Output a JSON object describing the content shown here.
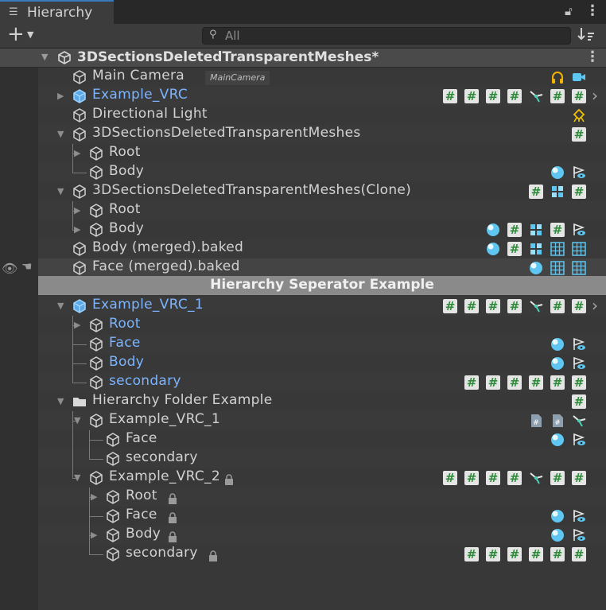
{
  "window": {
    "tab_icon": "list-icon",
    "tab_label": "Hierarchy",
    "lock_icon": "padlock-icon",
    "menu_icon": "kebab-menu-icon"
  },
  "toolbar": {
    "add_icon": "plus-icon",
    "search_placeholder": "All",
    "search_value": "",
    "filter_icon": "sort-filter-icon"
  },
  "scene": {
    "name": "3DSectionsDeletedTransparentMeshes*",
    "icon": "unity-logo-icon"
  },
  "separator": {
    "label": "Hierarchy Seperator Example"
  },
  "rows": [
    {
      "label": "Main Camera",
      "tag": "MainCamera",
      "blue": false,
      "icons": [
        "headphones-icon",
        "camera-icon"
      ]
    },
    {
      "label": "Example_VRC",
      "blue": true,
      "icons": [
        "script-icon",
        "script-icon",
        "script-icon",
        "script-icon",
        "ik-icon",
        "script-icon",
        "script-icon"
      ]
    },
    {
      "label": "Directional Light",
      "blue": false,
      "icons": [
        "light-icon"
      ]
    },
    {
      "label": "3DSectionsDeletedTransparentMeshes",
      "blue": false,
      "icons": [
        "script-icon"
      ]
    },
    {
      "label": "Root",
      "blue": false,
      "icons": []
    },
    {
      "label": "Body",
      "blue": false,
      "icons": [
        "sphere-icon",
        "visibility-icon"
      ]
    },
    {
      "label": "3DSectionsDeletedTransparentMeshes(Clone)",
      "blue": false,
      "icons": [
        "script-icon",
        "blocks-icon",
        "script-icon"
      ]
    },
    {
      "label": "Root",
      "blue": false,
      "icons": []
    },
    {
      "label": "Body",
      "blue": false,
      "icons": [
        "sphere-icon",
        "script-icon",
        "blocks-icon",
        "script-icon",
        "visibility-icon"
      ]
    },
    {
      "label": "Body (merged).baked",
      "blue": false,
      "icons": [
        "sphere-icon",
        "script-icon",
        "blocks-icon",
        "grid-icon",
        "grid-icon"
      ]
    },
    {
      "label": "Face (merged).baked",
      "blue": false,
      "icons": [
        "sphere-icon",
        "grid-icon",
        "grid-icon"
      ]
    },
    {
      "label": "Example_VRC_1",
      "blue": true,
      "icons": [
        "script-icon",
        "script-icon",
        "script-icon",
        "script-icon",
        "ik-icon",
        "script-icon",
        "script-icon"
      ]
    },
    {
      "label": "Root",
      "blue": true,
      "icons": []
    },
    {
      "label": "Face",
      "blue": true,
      "icons": [
        "sphere-icon",
        "visibility-icon"
      ]
    },
    {
      "label": "Body",
      "blue": true,
      "icons": [
        "sphere-icon",
        "visibility-icon"
      ]
    },
    {
      "label": "secondary",
      "blue": true,
      "icons": [
        "script-icon",
        "script-icon",
        "script-icon",
        "script-icon",
        "script-icon",
        "script-icon"
      ]
    },
    {
      "label": "Hierarchy Folder Example",
      "blue": false,
      "icons": [
        "script-icon"
      ]
    },
    {
      "label": "Example_VRC_1",
      "blue": false,
      "icons": [
        "doc-script-icon",
        "doc-script-icon",
        "ik-icon"
      ]
    },
    {
      "label": "Face",
      "blue": false,
      "icons": [
        "sphere-icon",
        "visibility-icon"
      ]
    },
    {
      "label": "secondary",
      "blue": false,
      "icons": []
    },
    {
      "label": "Example_VRC_2",
      "blue": false,
      "locked": true,
      "icons": [
        "script-icon",
        "script-icon",
        "script-icon",
        "script-icon",
        "ik-icon",
        "script-icon",
        "script-icon"
      ]
    },
    {
      "label": "Root",
      "blue": false,
      "locked": true,
      "icons": []
    },
    {
      "label": "Face",
      "blue": false,
      "locked": true,
      "icons": [
        "sphere-icon",
        "visibility-icon"
      ]
    },
    {
      "label": "Body",
      "blue": false,
      "locked": true,
      "icons": [
        "sphere-icon",
        "visibility-icon"
      ]
    },
    {
      "label": "secondary",
      "blue": false,
      "locked": true,
      "icons": [
        "script-icon",
        "script-icon",
        "script-icon",
        "script-icon",
        "script-icon",
        "script-icon"
      ]
    }
  ],
  "colors": {
    "background": "#383838",
    "blue_label": "#7cb4ff",
    "script_green": "#2e8b3a",
    "accent_cyan": "#5ec6f0"
  }
}
